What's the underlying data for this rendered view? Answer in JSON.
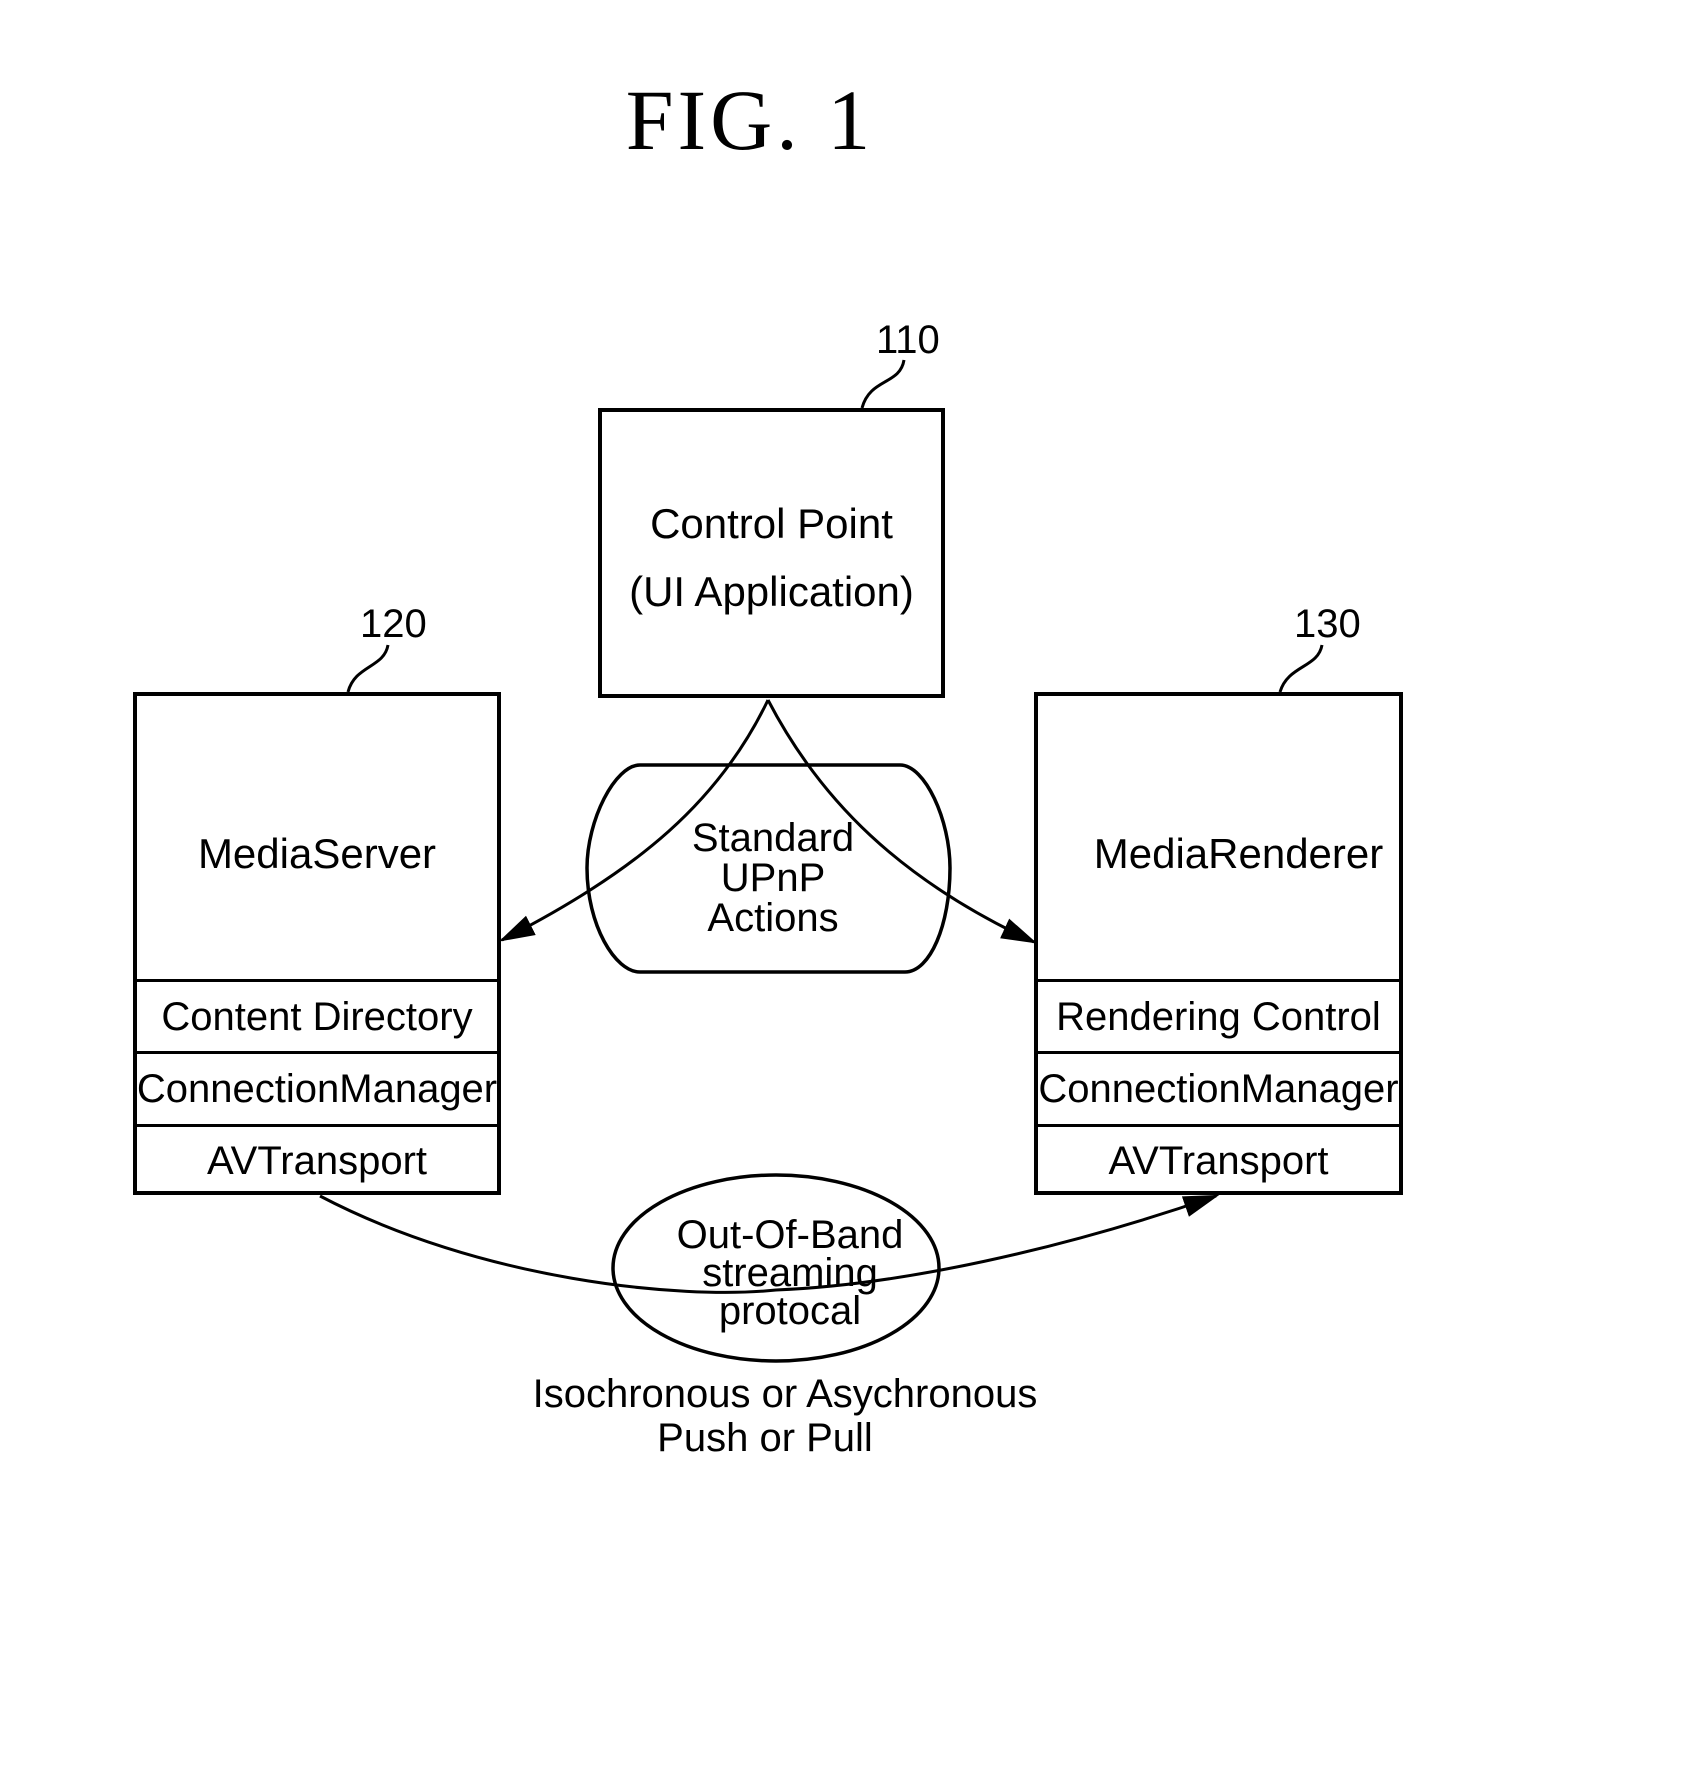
{
  "figure": {
    "title": "FIG. 1"
  },
  "control_point": {
    "ref": "110",
    "line1": "Control Point",
    "line2": "(UI Application)"
  },
  "media_server": {
    "ref": "120",
    "name": "MediaServer",
    "services": [
      "Content Directory",
      "ConnectionManager",
      "AVTransport"
    ]
  },
  "media_renderer": {
    "ref": "130",
    "name": "MediaRenderer",
    "services": [
      "Rendering Control",
      "ConnectionManager",
      "AVTransport"
    ]
  },
  "upnp_actions": {
    "lines": [
      "Standard",
      "UPnP",
      "Actions"
    ]
  },
  "streaming": {
    "lines": [
      "Out-Of-Band",
      "streaming",
      "protocal"
    ]
  },
  "caption": {
    "line1": "Isochronous or Asychronous",
    "line2": "Push or Pull"
  }
}
